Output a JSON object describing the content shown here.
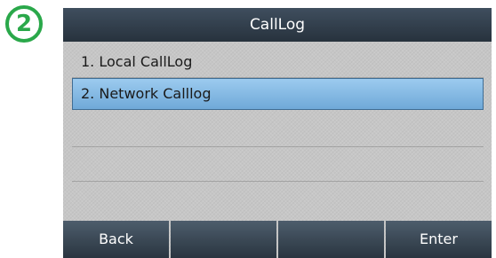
{
  "step_badge": "2",
  "screen": {
    "title": "CallLog",
    "menu_items": [
      {
        "label": "1. Local CallLog",
        "selected": false
      },
      {
        "label": "2. Network Calllog",
        "selected": true
      }
    ],
    "softkeys": [
      "Back",
      "",
      "",
      "Enter"
    ]
  },
  "colors": {
    "badge": "#2aa84a",
    "title_bar": "#2f3b47",
    "selection": "#7fb6e3",
    "background": "#c6c6c6"
  }
}
